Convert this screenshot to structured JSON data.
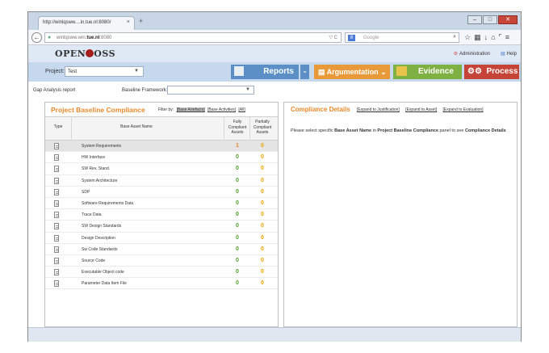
{
  "browser": {
    "tab_title": "http://winlqsww....in.tue.nl:8080/",
    "tab_close": "×",
    "new_tab": "+",
    "url_prefix": "winlqsww.win.",
    "url_bold": "tue.nl",
    "url_suffix": ":8080",
    "search_engine_initial": "8",
    "search_placeholder": "Google",
    "window_buttons": [
      "–",
      "□",
      "✕"
    ]
  },
  "app": {
    "logo_left": "OPEN",
    "logo_right": "OSS",
    "administration_label": "Administration",
    "help_label": "Help"
  },
  "menubar": {
    "project_label": "Project:",
    "project_value": "Test",
    "nav": {
      "reports": "Reports",
      "argumentation": "Argumentation",
      "evidence": "Evidence",
      "process": "Process"
    }
  },
  "filters": {
    "gap_label": "Gap Analysis report",
    "baseline_label": "Baseline Framework:",
    "baseline_value": ""
  },
  "left_panel": {
    "title": "Project Baseline Compliance",
    "filter_by": "Filter by:",
    "filter_links": [
      "[Base Artefacts]",
      "[Base Activities]",
      "[All]"
    ],
    "headers": {
      "type": "Type",
      "name": "Base Asset Name",
      "fully": "Fully Compliant Assets",
      "partial": "Partially Compliant Assets"
    },
    "rows": [
      {
        "name": "System Requirements",
        "fully": "1",
        "partial": "0"
      },
      {
        "name": "HW Interface",
        "fully": "0",
        "partial": "0"
      },
      {
        "name": "SW Rev. Stand.",
        "fully": "0",
        "partial": "0"
      },
      {
        "name": "System Architecture",
        "fully": "0",
        "partial": "0"
      },
      {
        "name": "SDP",
        "fully": "0",
        "partial": "0"
      },
      {
        "name": "Software Requirements Data",
        "fully": "0",
        "partial": "0"
      },
      {
        "name": "Trace Data",
        "fully": "0",
        "partial": "0"
      },
      {
        "name": "SW Design Standards",
        "fully": "0",
        "partial": "0"
      },
      {
        "name": "Design Description",
        "fully": "0",
        "partial": "0"
      },
      {
        "name": "Sw Code Standards",
        "fully": "0",
        "partial": "0"
      },
      {
        "name": "Source Code",
        "fully": "0",
        "partial": "0"
      },
      {
        "name": "Executable Object code",
        "fully": "0",
        "partial": "0"
      },
      {
        "name": "Parameter Data Item File",
        "fully": "0",
        "partial": "0"
      }
    ]
  },
  "right_panel": {
    "title": "Compliance Details",
    "links": [
      "[Expand to Justification]",
      "[Expand to Asset]",
      "[Expand to Evaluation]"
    ],
    "msg_1": "Please select specific ",
    "msg_2": "Base Asset Name",
    "msg_3": " in ",
    "msg_4": "Project Baseline Compliance",
    "msg_5": " panel to see ",
    "msg_6": "Compliance Details"
  },
  "colors": {
    "accent_orange": "#e8892b",
    "compliant_green": "#4d9a2a",
    "reports_blue": "#5b8fc6",
    "argumentation_orange": "#e89a3b",
    "evidence_green": "#7fb043",
    "process_red": "#c54337"
  },
  "icons": [
    "back-arrow-icon",
    "globe-icon",
    "reload-icon",
    "search-icon",
    "star-icon",
    "bookmarks-icon",
    "download-icon",
    "home-icon",
    "menu-icon",
    "gear-icon",
    "help-icon",
    "report-icon",
    "argumentation-icon",
    "evidence-icon",
    "process-gear-icon",
    "document-icon"
  ]
}
